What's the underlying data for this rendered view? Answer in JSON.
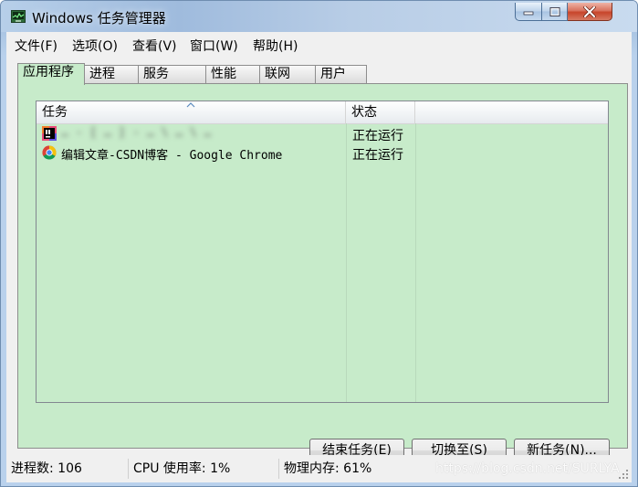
{
  "window": {
    "title": "Windows 任务管理器"
  },
  "menu": [
    {
      "label": "文件(F)"
    },
    {
      "label": "选项(O)"
    },
    {
      "label": "查看(V)"
    },
    {
      "label": "窗口(W)"
    },
    {
      "label": "帮助(H)"
    }
  ],
  "tabs": [
    {
      "label": "应用程序",
      "active": true
    },
    {
      "label": "进程",
      "active": false
    },
    {
      "label": "服务",
      "active": false
    },
    {
      "label": "性能",
      "active": false
    },
    {
      "label": "联网",
      "active": false
    },
    {
      "label": "用户",
      "active": false
    }
  ],
  "columns": {
    "task": "任务",
    "status": "状态"
  },
  "tasks": [
    {
      "name": "… - [ … ] - … \\ … \\ …",
      "status": "正在运行",
      "icon": "intellij-idea-icon",
      "blurred": true
    },
    {
      "name": "编辑文章-CSDN博客 - Google Chrome",
      "status": "正在运行",
      "icon": "chrome-icon",
      "blurred": false
    }
  ],
  "buttons": {
    "end_task": {
      "text": "结束任务(",
      "key": "E",
      "tail": ")"
    },
    "switch_to": {
      "text": "切换至(",
      "key": "S",
      "tail": ")"
    },
    "new_task": {
      "text": "新任务(",
      "key": "N",
      "tail": ")..."
    }
  },
  "statusbar": {
    "processes": "进程数: 106",
    "cpu": "CPU 使用率: 1%",
    "memory": "物理内存: 61%",
    "watermark": "https://blog.csdn.net/SURLYA"
  },
  "colors": {
    "panel_bg": "#c7ebca",
    "close_button": "#c7442a"
  }
}
